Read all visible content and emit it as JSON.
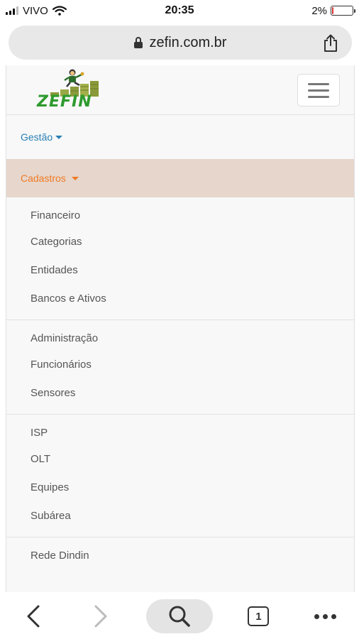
{
  "status": {
    "carrier": "VIVO",
    "time": "20:35",
    "battery": "2%",
    "battery_level": 0.02
  },
  "browser": {
    "url": "zefin.com.br",
    "tab_count": "1"
  },
  "site": {
    "logo_text": "ZEFIN"
  },
  "menu": {
    "top_item": "Gestão",
    "active_item": "Cadastros",
    "groups": [
      {
        "items": [
          "Financeiro",
          "Categorias",
          "Entidades",
          "Bancos e Ativos"
        ]
      },
      {
        "items": [
          "Administração",
          "Funcionários",
          "Sensores"
        ]
      },
      {
        "items": [
          "ISP",
          "OLT",
          "Equipes",
          "Subárea"
        ]
      },
      {
        "items": [
          "Rede Dindin"
        ]
      }
    ]
  },
  "colors": {
    "link": "#2a7fb4",
    "active_text": "#f07a24",
    "active_bg": "#e6d6cc",
    "logo_green": "#2e9b2e"
  }
}
